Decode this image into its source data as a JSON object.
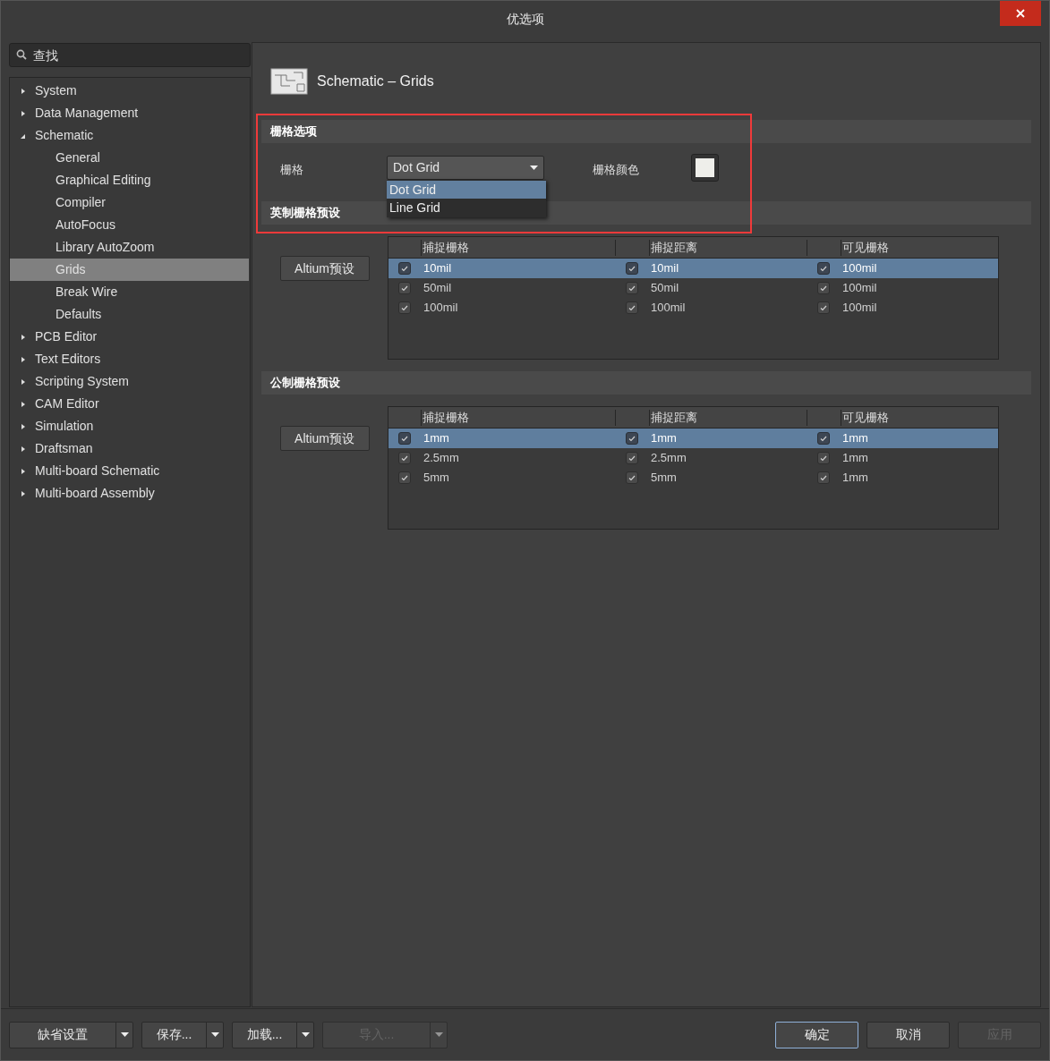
{
  "window": {
    "title": "优选项"
  },
  "search": {
    "placeholder": "查找"
  },
  "tree": [
    {
      "label": "System",
      "expanded": false,
      "selected": false
    },
    {
      "label": "Data Management",
      "expanded": false,
      "selected": false
    },
    {
      "label": "Schematic",
      "expanded": true,
      "selected": false,
      "children": [
        {
          "label": "General",
          "selected": false
        },
        {
          "label": "Graphical Editing",
          "selected": false
        },
        {
          "label": "Compiler",
          "selected": false
        },
        {
          "label": "AutoFocus",
          "selected": false
        },
        {
          "label": "Library AutoZoom",
          "selected": false
        },
        {
          "label": "Grids",
          "selected": true
        },
        {
          "label": "Break Wire",
          "selected": false
        },
        {
          "label": "Defaults",
          "selected": false
        }
      ]
    },
    {
      "label": "PCB Editor",
      "expanded": false,
      "selected": false
    },
    {
      "label": "Text Editors",
      "expanded": false,
      "selected": false
    },
    {
      "label": "Scripting System",
      "expanded": false,
      "selected": false
    },
    {
      "label": "CAM Editor",
      "expanded": false,
      "selected": false
    },
    {
      "label": "Simulation",
      "expanded": false,
      "selected": false
    },
    {
      "label": "Draftsman",
      "expanded": false,
      "selected": false
    },
    {
      "label": "Multi-board Schematic",
      "expanded": false,
      "selected": false
    },
    {
      "label": "Multi-board Assembly",
      "expanded": false,
      "selected": false
    }
  ],
  "page": {
    "title": "Schematic – Grids"
  },
  "grid_options": {
    "title": "栅格选项",
    "grid_label": "栅格",
    "grid_value": "Dot Grid",
    "expanded": true,
    "options": [
      {
        "label": "Dot Grid",
        "selected": true
      },
      {
        "label": "Line Grid",
        "selected": false
      }
    ],
    "color_label": "栅格颜色",
    "color": "#eeeeea"
  },
  "presets": [
    {
      "title": "英制栅格预设",
      "button": "Altium预设",
      "columns": [
        "捕捉栅格",
        "捕捉距离",
        "可见栅格"
      ],
      "rows": [
        {
          "selected": true,
          "cells": [
            {
              "checked": true,
              "value": "10mil"
            },
            {
              "checked": true,
              "value": "10mil"
            },
            {
              "checked": true,
              "value": "100mil"
            }
          ]
        },
        {
          "selected": false,
          "cells": [
            {
              "checked": true,
              "value": "50mil"
            },
            {
              "checked": true,
              "value": "50mil"
            },
            {
              "checked": true,
              "value": "100mil"
            }
          ]
        },
        {
          "selected": false,
          "cells": [
            {
              "checked": true,
              "value": "100mil"
            },
            {
              "checked": true,
              "value": "100mil"
            },
            {
              "checked": true,
              "value": "100mil"
            }
          ]
        }
      ]
    },
    {
      "title": "公制栅格预设",
      "button": "Altium预设",
      "columns": [
        "捕捉栅格",
        "捕捉距离",
        "可见栅格"
      ],
      "rows": [
        {
          "selected": true,
          "cells": [
            {
              "checked": true,
              "value": "1mm"
            },
            {
              "checked": true,
              "value": "1mm"
            },
            {
              "checked": true,
              "value": "1mm"
            }
          ]
        },
        {
          "selected": false,
          "cells": [
            {
              "checked": true,
              "value": "2.5mm"
            },
            {
              "checked": true,
              "value": "2.5mm"
            },
            {
              "checked": true,
              "value": "1mm"
            }
          ]
        },
        {
          "selected": false,
          "cells": [
            {
              "checked": true,
              "value": "5mm"
            },
            {
              "checked": true,
              "value": "5mm"
            },
            {
              "checked": true,
              "value": "1mm"
            }
          ]
        }
      ]
    }
  ],
  "buttons": [
    {
      "label": "缺省设置",
      "kind": "split",
      "disabled": false,
      "focused": false
    },
    {
      "label": "保存...",
      "kind": "split",
      "disabled": false,
      "focused": false
    },
    {
      "label": "加载...",
      "kind": "split",
      "disabled": false,
      "focused": false
    },
    {
      "label": "导入...",
      "kind": "split",
      "disabled": true,
      "focused": false
    },
    {
      "label": "确定",
      "kind": "plain",
      "disabled": false,
      "focused": true
    },
    {
      "label": "取消",
      "kind": "plain",
      "disabled": false,
      "focused": false
    },
    {
      "label": "应用",
      "kind": "plain",
      "disabled": true,
      "focused": false
    }
  ]
}
